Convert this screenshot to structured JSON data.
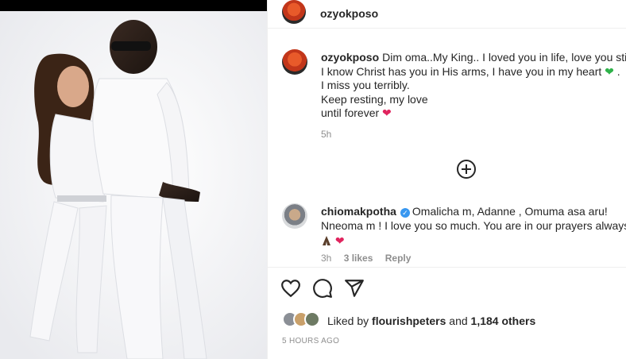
{
  "post": {
    "author": "ozyokposo",
    "photo_alt": "photo"
  },
  "caption": {
    "username": "ozyokposo",
    "lines": [
      "Dim oma..My King.. I loved you in life, love you still",
      "I know Christ has you in His arms, I have you in my heart",
      "I miss you terribly.",
      "Keep resting, my love",
      "until forever"
    ],
    "line2_suffix": ".",
    "time": "5h"
  },
  "load_more": {
    "icon": "plus-circle-icon"
  },
  "comment": {
    "username": "chiomakpotha",
    "verified_icon": "verified-badge-icon",
    "lines": [
      "Omalicha m, Adanne , Omuma asa aru!",
      "Nneoma m ! I love you so much. You are in our prayers always"
    ],
    "time": "3h",
    "likes": "3 likes",
    "reply": "Reply"
  },
  "actions": {
    "like_icon": "heart-outline-icon",
    "comment_icon": "comment-bubble-icon",
    "share_icon": "paper-plane-icon"
  },
  "likes": {
    "prefix": "Liked by",
    "user": "flourishpeters",
    "and": "and",
    "others": "1,184 others"
  },
  "timestamp": "5 HOURS AGO",
  "colors": {
    "text": "#262626",
    "muted": "#8e8e8e",
    "verified": "#3897f0",
    "heart_red": "#e0245e",
    "heart_green": "#2fb24a",
    "divider": "#efefef"
  }
}
